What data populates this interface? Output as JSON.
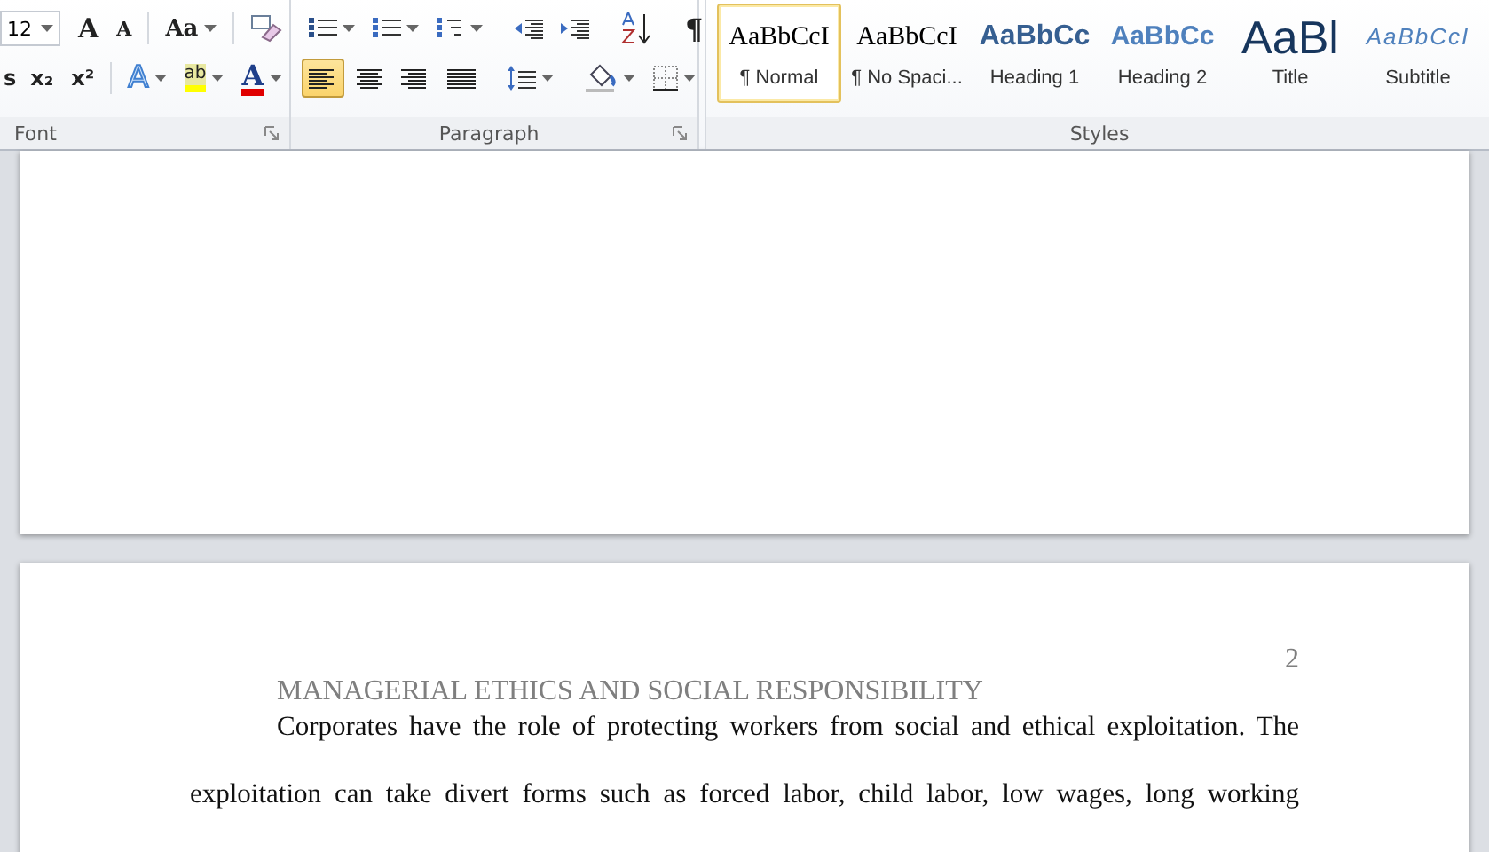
{
  "ribbon": {
    "font_group": {
      "label": "Font",
      "font_size": "12",
      "row1": [
        {
          "kind": "grow-font",
          "glyph": "A",
          "dropdown": false
        },
        {
          "kind": "shrink-font",
          "glyph": "A",
          "dropdown": false
        },
        {
          "kind": "sep"
        },
        {
          "kind": "change-case",
          "glyph": "Aa",
          "dropdown": true
        },
        {
          "kind": "sep"
        },
        {
          "kind": "clear-formatting",
          "dropdown": false
        }
      ],
      "row2": [
        {
          "kind": "strikethrough",
          "glyph": "s",
          "dropdown": false
        },
        {
          "kind": "subscript",
          "glyph": "x₂",
          "dropdown": false
        },
        {
          "kind": "superscript",
          "glyph": "x²",
          "dropdown": false
        },
        {
          "kind": "sep"
        },
        {
          "kind": "text-effects",
          "glyph": "A",
          "dropdown": true
        },
        {
          "kind": "highlight",
          "glyph": "ab",
          "dropdown": true
        },
        {
          "kind": "font-color",
          "glyph": "A",
          "dropdown": true
        }
      ]
    },
    "paragraph_group": {
      "label": "Paragraph",
      "row1": [
        {
          "kind": "bullets",
          "dropdown": true
        },
        {
          "kind": "numbering",
          "dropdown": true
        },
        {
          "kind": "multilevel-list",
          "dropdown": true
        },
        {
          "kind": "sep"
        },
        {
          "kind": "decrease-indent",
          "dropdown": false
        },
        {
          "kind": "increase-indent",
          "dropdown": false
        },
        {
          "kind": "sep"
        },
        {
          "kind": "sort",
          "dropdown": false
        },
        {
          "kind": "sep"
        },
        {
          "kind": "show-marks",
          "glyph": "¶",
          "dropdown": false
        }
      ],
      "row2": [
        {
          "kind": "align-left",
          "dropdown": false,
          "selected": true
        },
        {
          "kind": "align-center",
          "dropdown": false,
          "selected": false
        },
        {
          "kind": "align-right",
          "dropdown": false,
          "selected": false
        },
        {
          "kind": "justify",
          "dropdown": false,
          "selected": false
        },
        {
          "kind": "sep"
        },
        {
          "kind": "line-spacing",
          "dropdown": true
        },
        {
          "kind": "sep"
        },
        {
          "kind": "shading",
          "dropdown": true
        },
        {
          "kind": "borders",
          "dropdown": true
        }
      ]
    },
    "styles_group": {
      "label": "Styles",
      "items": [
        {
          "kind": "normal",
          "preview": "AaBbCcI",
          "label": "¶ Normal",
          "selected": true
        },
        {
          "kind": "normal",
          "preview": "AaBbCcI",
          "label": "¶ No Spaci...",
          "selected": false
        },
        {
          "kind": "heading1",
          "preview": "AaBbCc",
          "label": "Heading 1",
          "selected": false
        },
        {
          "kind": "heading2",
          "preview": "AaBbCc",
          "label": "Heading 2",
          "selected": false
        },
        {
          "kind": "title",
          "preview": "AaBl",
          "label": "Title",
          "selected": false
        },
        {
          "kind": "subtitle",
          "preview": "AaBbCcI",
          "label": "Subtitle",
          "selected": false
        }
      ]
    }
  },
  "document": {
    "page2": {
      "header": "MANAGERIAL ETHICS AND SOCIAL RESPONSIBILITY",
      "page_number": "2",
      "lines": [
        "Corporates have the role of protecting workers from social and ethical exploitation. The",
        "exploitation can take divert forms such as forced labor, child labor, low wages, long working"
      ]
    }
  }
}
